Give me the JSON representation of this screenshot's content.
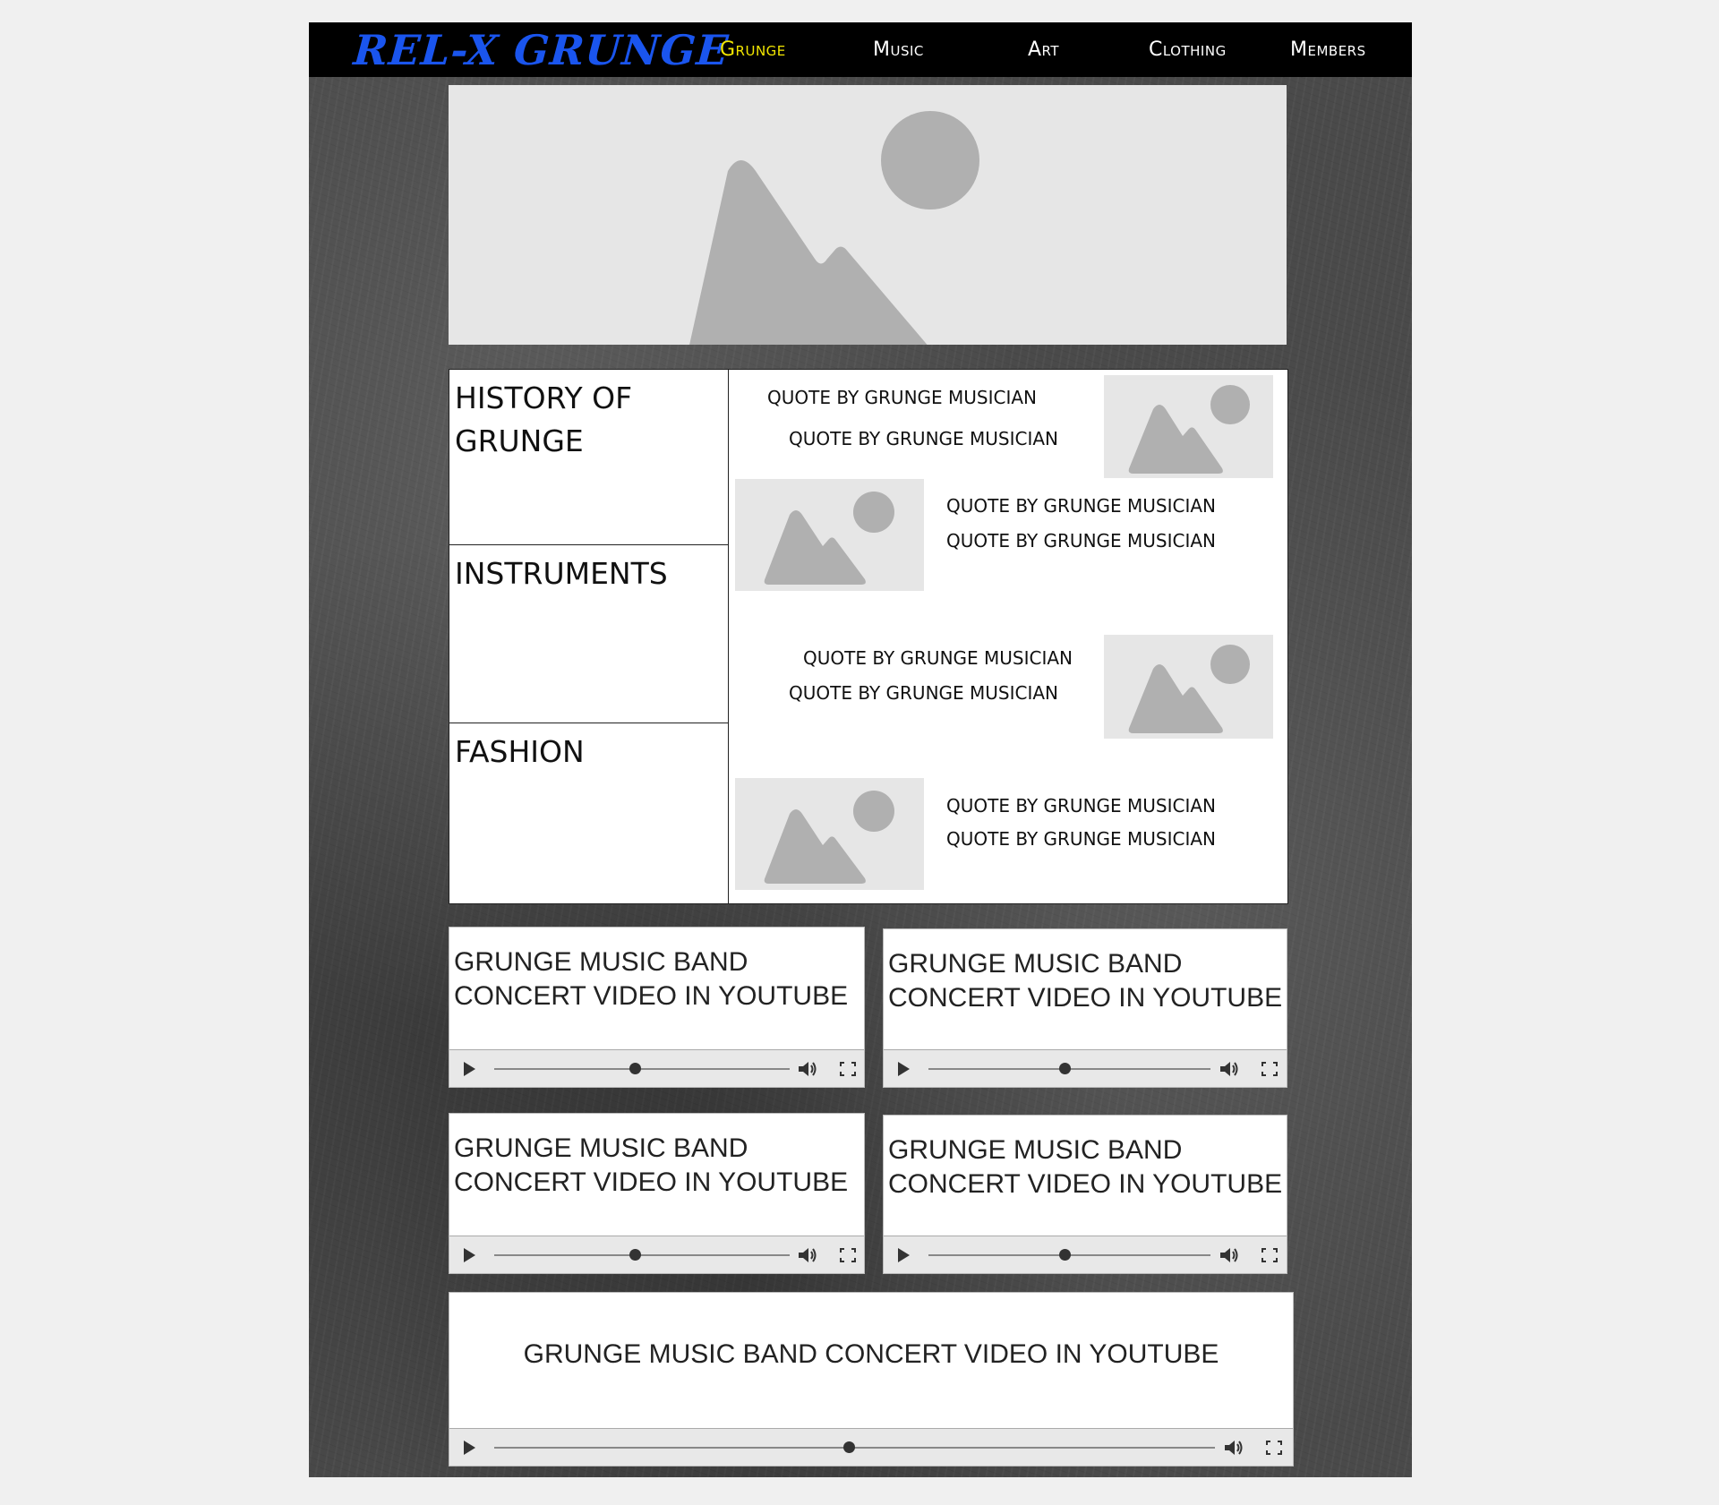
{
  "header": {
    "logo": "REL-X GRUNGE",
    "nav": [
      {
        "label": "Grunge",
        "active": true
      },
      {
        "label": "Music",
        "active": false
      },
      {
        "label": "Art",
        "active": false
      },
      {
        "label": "Clothing",
        "active": false
      },
      {
        "label": "Members",
        "active": false
      }
    ]
  },
  "sections": [
    {
      "title": "HISTORY OF GRUNGE"
    },
    {
      "title": "INSTRUMENTS"
    },
    {
      "title": "FASHION"
    }
  ],
  "quotes": [
    "QUOTE BY GRUNGE MUSICIAN",
    "QUOTE BY GRUNGE MUSICIAN",
    "QUOTE BY GRUNGE MUSICIAN",
    "QUOTE BY GRUNGE MUSICIAN",
    "QUOTE BY GRUNGE MUSICIAN",
    "QUOTE BY GRUNGE MUSICIAN",
    "QUOTE BY GRUNGE MUSICIAN",
    "QUOTE BY GRUNGE MUSICIAN"
  ],
  "videos": [
    {
      "title_line1": "GRUNGE MUSIC BAND",
      "title_line2": "CONCERT VIDEO IN YOUTUBE"
    },
    {
      "title_line1": "GRUNGE MUSIC BAND",
      "title_line2": "CONCERT VIDEO IN YOUTUBE"
    },
    {
      "title_line1": "GRUNGE MUSIC BAND",
      "title_line2": "CONCERT VIDEO IN YOUTUBE"
    },
    {
      "title_line1": "GRUNGE MUSIC BAND",
      "title_line2": "CONCERT VIDEO IN YOUTUBE"
    },
    {
      "title": "GRUNGE MUSIC BAND CONCERT VIDEO IN YOUTUBE"
    }
  ],
  "colors": {
    "logo": "#1a55ee",
    "nav_active": "#f2e600",
    "navbar_bg": "#000000",
    "placeholder_bg": "#e6e6e6",
    "placeholder_icon": "#b0b0b0"
  }
}
